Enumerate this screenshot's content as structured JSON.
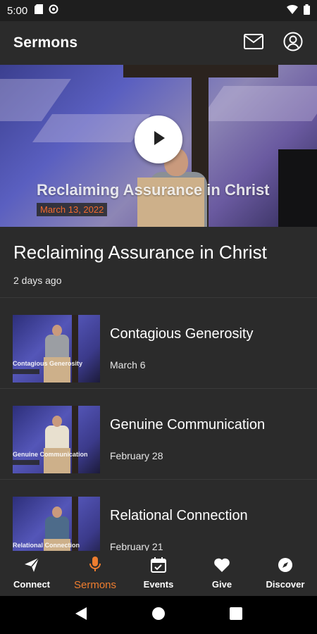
{
  "status": {
    "time": "5:00"
  },
  "app": {
    "title": "Sermons"
  },
  "hero": {
    "overlay_title": "Reclaiming Assurance in Christ",
    "overlay_date": "March 13, 2022"
  },
  "featured": {
    "title": "Reclaiming Assurance in Christ",
    "meta": "2 days ago"
  },
  "sermons": [
    {
      "title": "Contagious Generosity",
      "date": "March 6",
      "thumb_caption": "Contagious Generosity",
      "shirt": "#9b9ea3"
    },
    {
      "title": "Genuine Communication",
      "date": "February 28",
      "thumb_caption": "Genuine Communication",
      "shirt": "#e8e0cf"
    },
    {
      "title": "Relational Connection",
      "date": "February 21",
      "thumb_caption": "Relational Connection",
      "shirt": "#4d6b8a"
    }
  ],
  "bottom_nav": [
    {
      "label": "Connect",
      "icon": "paper-plane-icon",
      "active": false
    },
    {
      "label": "Sermons",
      "icon": "microphone-icon",
      "active": true
    },
    {
      "label": "Events",
      "icon": "calendar-icon",
      "active": false
    },
    {
      "label": "Give",
      "icon": "heart-icon",
      "active": false
    },
    {
      "label": "Discover",
      "icon": "compass-icon",
      "active": false
    }
  ],
  "colors": {
    "accent": "#ee7d2f",
    "background": "#2b2b2b"
  }
}
